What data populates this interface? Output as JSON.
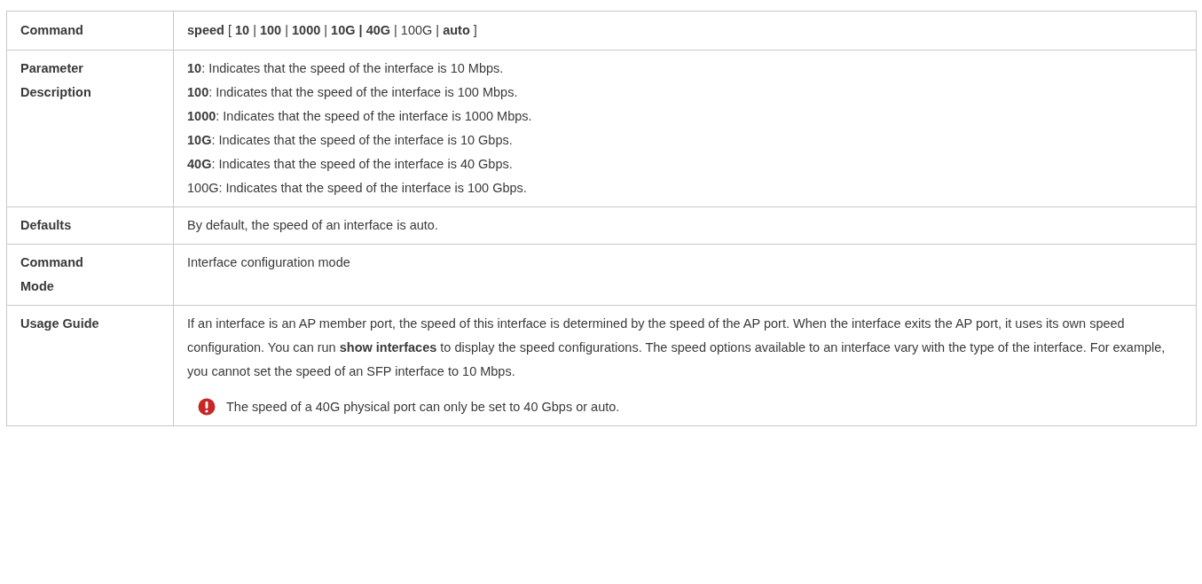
{
  "table": {
    "rows": [
      {
        "kind": "text",
        "label": "Command",
        "lines": [
          "**speed** [ **10** | **100** | **1000** | **10G | 40G** | 100G | **auto** ]"
        ]
      },
      {
        "kind": "text",
        "label": "Parameter Description",
        "lines": [
          "**10**: Indicates that the speed of the interface is 10 Mbps.",
          "**100**: Indicates that the speed of the interface is 100 Mbps.",
          "**1000**: Indicates that the speed of the interface is 1000 Mbps.",
          "**10G**: Indicates that the speed of the interface is 10 Gbps.",
          "**40G**: Indicates that the speed of the interface is 40 Gbps.",
          "100G: Indicates that the speed of the interface is 100 Gbps."
        ]
      },
      {
        "kind": "text",
        "label": "Defaults",
        "lines": [
          "By default, the speed of an interface is auto."
        ]
      },
      {
        "kind": "text",
        "label": "Command Mode",
        "lines": [
          "Interface configuration mode"
        ]
      },
      {
        "kind": "guide",
        "label": "Usage Guide",
        "lines": [
          "If an interface is an AP member port, the speed of this interface is determined by the speed of the AP port. When the interface exits the AP port, it uses its own speed configuration. You can run **show interfaces** to display the speed configurations. The speed options available to an interface vary with the type of the interface. For example, you cannot set the speed of an SFP interface to 10 Mbps."
        ],
        "note": "The speed of a 40G physical port can only be set to 40 Gbps or auto."
      }
    ]
  }
}
